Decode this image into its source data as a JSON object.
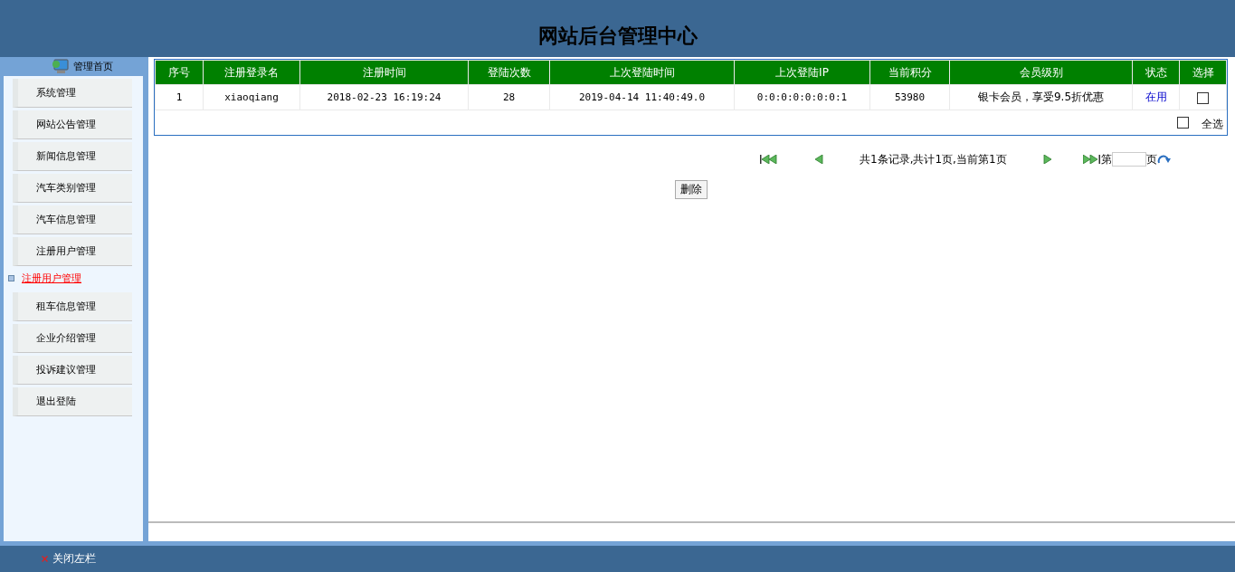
{
  "header": {
    "title": "网站后台管理中心"
  },
  "sidebar": {
    "home": "管理首页",
    "items": [
      {
        "label": "系统管理"
      },
      {
        "label": "网站公告管理"
      },
      {
        "label": "新闻信息管理"
      },
      {
        "label": "汽车类别管理"
      },
      {
        "label": "汽车信息管理"
      },
      {
        "label": "注册用户管理",
        "children": [
          {
            "label": "注册用户管理",
            "selected": true
          }
        ]
      },
      {
        "label": "租车信息管理"
      },
      {
        "label": "企业介绍管理"
      },
      {
        "label": "投诉建议管理"
      },
      {
        "label": "退出登陆"
      }
    ]
  },
  "table": {
    "columns": [
      "序号",
      "注册登录名",
      "注册时间",
      "登陆次数",
      "上次登陆时间",
      "上次登陆IP",
      "当前积分",
      "会员级别",
      "状态",
      "选择"
    ],
    "rows": [
      {
        "cells": [
          "1",
          "xiaoqiang",
          "2018-02-23 16:19:24",
          "28",
          "2019-04-14 11:40:49.0",
          "0:0:0:0:0:0:0:1",
          "53980",
          "银卡会员，享受9.5折优惠"
        ],
        "status": "在用",
        "checked": false
      }
    ],
    "select_all": {
      "label": "全选",
      "checked": false
    }
  },
  "pagination": {
    "summary": "共1条记录,共计1页,当前第1页",
    "page_prefix": "第",
    "page_suffix": "页"
  },
  "delete_button": "删除",
  "footer": {
    "close_sidebar": "关闭左栏"
  }
}
